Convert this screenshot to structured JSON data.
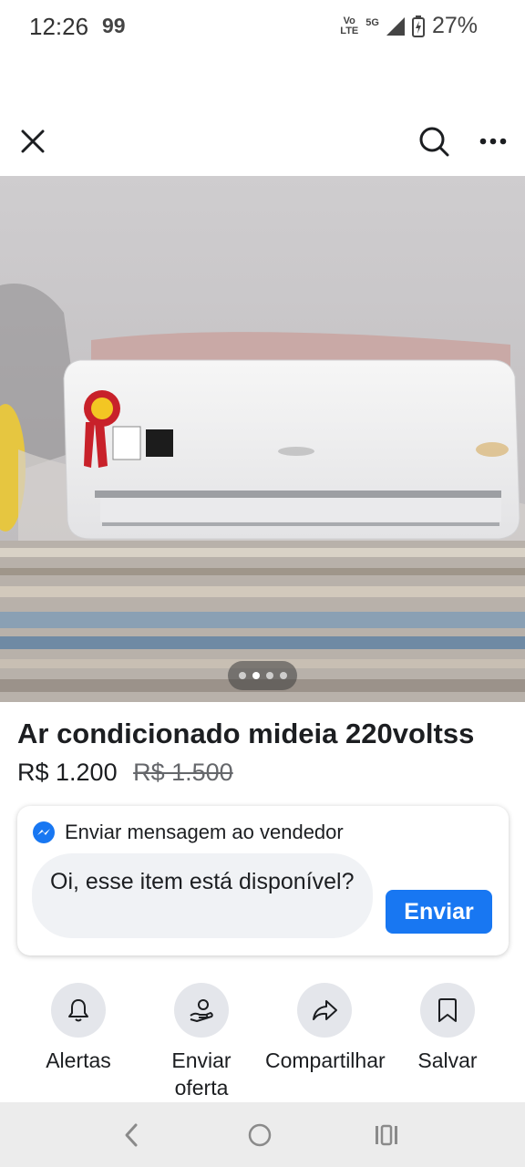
{
  "status_bar": {
    "time": "12:26",
    "notification": "99",
    "volte_top": "Vo",
    "volte_bottom": "LTE",
    "network": "5G",
    "battery": "27%"
  },
  "topbar": {
    "close_icon": "close-icon",
    "search_icon": "search-icon",
    "more_icon": "more-icon"
  },
  "gallery": {
    "image_count": 4,
    "active_index": 1
  },
  "listing": {
    "title": "Ar condicionado mideia 220voltss",
    "price": "R$ 1.200",
    "old_price": "R$ 1.500"
  },
  "message": {
    "header": "Enviar mensagem ao vendedor",
    "text": "Oi, esse item está disponível?",
    "send_label": "Enviar"
  },
  "actions": [
    {
      "label": "Alertas",
      "icon": "bell-icon"
    },
    {
      "label": "Enviar oferta",
      "icon": "offer-icon"
    },
    {
      "label": "Compartilhar",
      "icon": "share-icon"
    },
    {
      "label": "Salvar",
      "icon": "bookmark-icon"
    }
  ],
  "colors": {
    "accent": "#1877f2",
    "chip_bg": "#e4e6eb",
    "input_bg": "#f0f2f5"
  }
}
